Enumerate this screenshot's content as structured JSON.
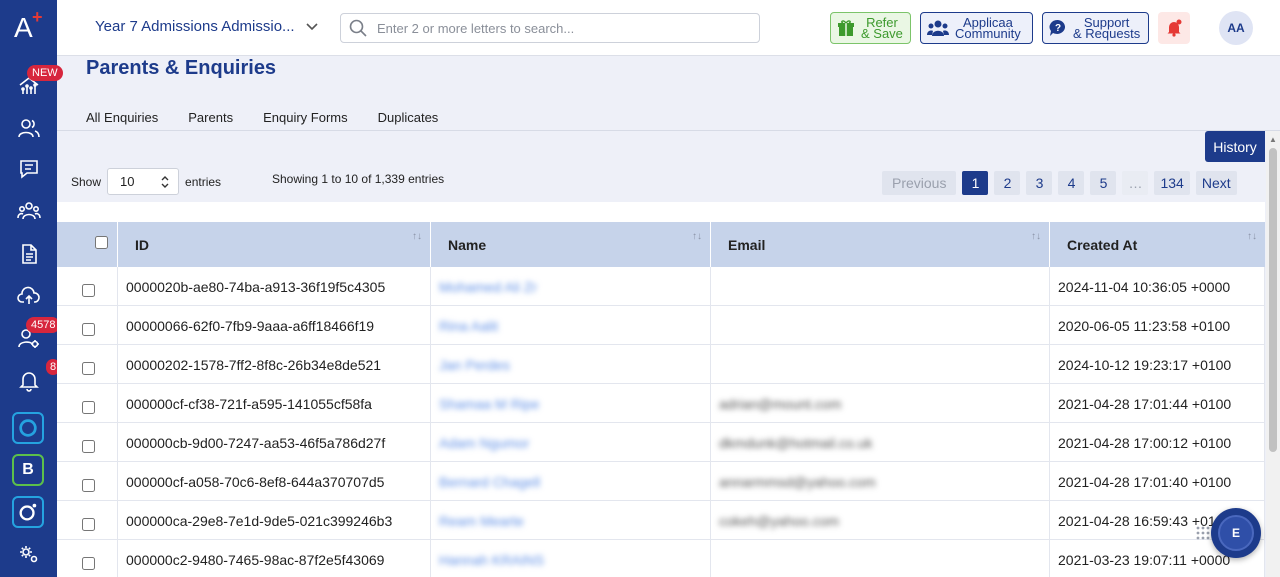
{
  "sidebar": {
    "badges": {
      "dashboard": "NEW",
      "registrations": "4578",
      "notifications": "8"
    },
    "apps": [
      "O",
      "B",
      "O"
    ]
  },
  "topbar": {
    "year_select": "Year 7 Admissions Admissio...",
    "search_placeholder": "Enter 2 or more letters to search...",
    "refer": [
      "Refer",
      "& Save"
    ],
    "community": [
      "Applicaa",
      "Community"
    ],
    "support": [
      "Support",
      "& Requests"
    ],
    "avatar": "AA"
  },
  "page": {
    "title": "Parents & Enquiries",
    "tabs": [
      "All Enquiries",
      "Parents",
      "Enquiry Forms",
      "Duplicates"
    ],
    "history": "History"
  },
  "controls": {
    "show_label": "Show",
    "entries_value": "10",
    "entries_label": "entries",
    "info": "Showing 1 to 10 of 1,339 entries",
    "pager": [
      "Previous",
      "1",
      "2",
      "3",
      "4",
      "5",
      "…",
      "134",
      "Next"
    ]
  },
  "table": {
    "columns": [
      "ID",
      "Name",
      "Email",
      "Created At"
    ],
    "rows": [
      {
        "id": "0000020b-ae80-74ba-a913-36f19f5c4305",
        "name": "Mohamed Ali Zr",
        "email": "",
        "created": "2024-11-04 10:36:05 +0000"
      },
      {
        "id": "00000066-62f0-7fb9-9aaa-a6ff18466f19",
        "name": "Rina Aalit",
        "email": "",
        "created": "2020-06-05 11:23:58 +0100"
      },
      {
        "id": "00000202-1578-7ff2-8f8c-26b34e8de521",
        "name": "Jan Perdes",
        "email": "",
        "created": "2024-10-12 19:23:17 +0100"
      },
      {
        "id": "000000cf-cf38-721f-a595-141055cf58fa",
        "name": "Shamaa M Ripe",
        "email": "adrian@mount.com",
        "created": "2021-04-28 17:01:44 +0100"
      },
      {
        "id": "000000cb-9d00-7247-aa53-46f5a786d27f",
        "name": "Adam Ngumor",
        "email": "dkmdunk@hotmail.co.uk",
        "created": "2021-04-28 17:00:12 +0100"
      },
      {
        "id": "000000cf-a058-70c6-8ef8-644a370707d5",
        "name": "Bernard Chagell",
        "email": "annarmmsd@yahoo.com",
        "created": "2021-04-28 17:01:40 +0100"
      },
      {
        "id": "000000ca-29e8-7e1d-9de5-021c399246b3",
        "name": "Ream Mearte",
        "email": "cokeh@yahoo.com",
        "created": "2021-04-28 16:59:43 +0100"
      },
      {
        "id": "000000c2-9480-7465-98ac-87f2e5f43069",
        "name": "Hannah KRAINS",
        "email": "",
        "created": "2021-03-23 19:07:11 +0000"
      }
    ]
  },
  "chat": {
    "label": "E"
  }
}
